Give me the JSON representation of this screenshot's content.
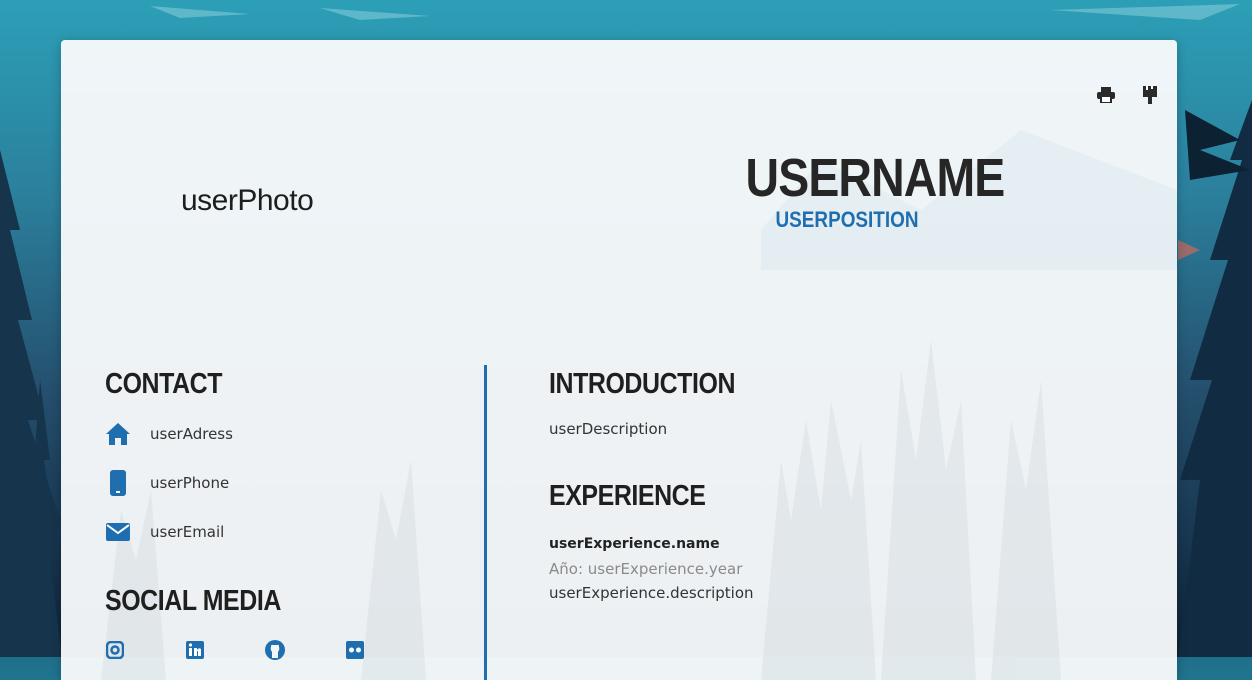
{
  "header": {
    "photo_placeholder": "userPhoto",
    "username": "USERNAME",
    "position": "USERPOSITION",
    "print_icon": "printer-icon",
    "theme_icon": "paint-brush-icon"
  },
  "contact": {
    "title": "CONTACT",
    "items": [
      {
        "icon": "home-icon",
        "text": "userAdress"
      },
      {
        "icon": "phone-icon",
        "text": "userPhone"
      },
      {
        "icon": "envelope-icon",
        "text": "userEmail"
      }
    ]
  },
  "social": {
    "title": "SOCIAL MEDIA",
    "items": [
      {
        "icon": "instagram-icon"
      },
      {
        "icon": "linkedin-icon"
      },
      {
        "icon": "github-icon"
      },
      {
        "icon": "flickr-icon"
      }
    ]
  },
  "introduction": {
    "title": "INTRODUCTION",
    "description": "userDescription"
  },
  "experience": {
    "title": "EXPERIENCE",
    "name": "userExperience.name",
    "year": "Año: userExperience.year",
    "description": "userExperience.description"
  },
  "colors": {
    "accent": "#1f6fb0",
    "heading": "#1f1f1f",
    "muted": "#8a8a8a"
  }
}
